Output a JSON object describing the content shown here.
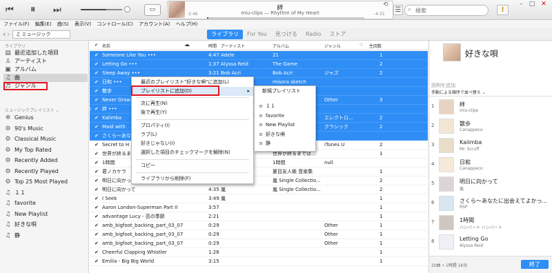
{
  "window": {
    "minimize": "–",
    "maximize": "□",
    "close": "✕"
  },
  "player": {
    "prev_icon": "⏮",
    "pause_icon": "⏸",
    "next_icon": "⏭",
    "shuffle_icon": "⤨",
    "repeat_icon": "⟲",
    "airplay_icon": "▭",
    "elapsed": "2:46",
    "remaining": "-4:31",
    "title": "絆",
    "subtitle": "miu-clips — Rhythm of My Heart",
    "list_icon": "☰"
  },
  "search": {
    "placeholder": "検索",
    "icon": "search-icon"
  },
  "menu": [
    "ファイル(F)",
    "編集(E)",
    "曲(S)",
    "表示(V)",
    "コントロール(C)",
    "アカウント(A)",
    "ヘルプ(H)"
  ],
  "nav": {
    "back": "‹",
    "forward": "›",
    "kind": "♫ ミュージック",
    "tabs": [
      "ライブラリ",
      "For You",
      "見つける",
      "Radio",
      "ストア"
    ]
  },
  "sidebar": {
    "library_header": "ライブラリ",
    "library": [
      {
        "icon": "▤",
        "label": "最近追加した項目"
      },
      {
        "icon": "♙",
        "label": "アーティスト"
      },
      {
        "icon": "▣",
        "label": "アルバム"
      },
      {
        "icon": "♫",
        "label": "曲"
      },
      {
        "icon": "♬",
        "label": "ジャンル"
      }
    ],
    "playlist_header": "ミュージックプレイリスト ⌄",
    "playlists": [
      {
        "icon": "✲",
        "label": "Genius"
      },
      {
        "icon": "⚙",
        "label": "90's Music"
      },
      {
        "icon": "⚙",
        "label": "Classical Music"
      },
      {
        "icon": "⚙",
        "label": "My Top Rated"
      },
      {
        "icon": "⚙",
        "label": "Recently Added"
      },
      {
        "icon": "⚙",
        "label": "Recently Played"
      },
      {
        "icon": "⚙",
        "label": "Top 25 Most Played"
      },
      {
        "icon": "♫",
        "label": "１１"
      },
      {
        "icon": "♫",
        "label": "favorite"
      },
      {
        "icon": "♫",
        "label": "New Playlist"
      },
      {
        "icon": "♫",
        "label": "好きな唄"
      },
      {
        "icon": "♫",
        "label": "静"
      }
    ]
  },
  "table": {
    "headers": {
      "check": "✔",
      "name": "名前",
      "cloud": "☁",
      "time": "時間",
      "artist": "アーティスト",
      "album": "アルバム",
      "genre": "ジャンル",
      "love": "♡",
      "plays": "生回数"
    },
    "rows": [
      {
        "name": "Someone Like You  •••",
        "time": "4:47",
        "artist": "Adele",
        "album": "21",
        "genre": "",
        "plays": "1"
      },
      {
        "name": "Letting Go  •••",
        "time": "1:37",
        "artist": "Alyssa Reid",
        "album": "The Game",
        "genre": "",
        "plays": "2"
      },
      {
        "name": "Sleep Away  •••",
        "time": "3:21",
        "artist": "Bob Acri",
        "album": "Bob Acri",
        "genre": "ジャズ",
        "plays": "2"
      },
      {
        "name": "日和  •••",
        "time": "",
        "artist": "",
        "album": "misora sketch",
        "genre": "",
        "plays": ""
      },
      {
        "name": "散歩",
        "time": "",
        "artist": "",
        "album": "",
        "genre": "",
        "plays": ""
      },
      {
        "name": "Never Grow",
        "time": "",
        "artist": "",
        "album": "",
        "genre": "Other",
        "plays": "3"
      },
      {
        "name": "絆  •••",
        "time": "",
        "artist": "",
        "album": "",
        "genre": "",
        "plays": ""
      },
      {
        "name": "Kalimba",
        "time": "",
        "artist": "",
        "album": "",
        "genre": "エレクトロ...",
        "plays": "2"
      },
      {
        "name": "Maid with",
        "time": "",
        "artist": "",
        "album": "",
        "genre": "クラシック",
        "plays": "2"
      },
      {
        "name": "さくら〜あな",
        "time": "",
        "artist": "",
        "album": "",
        "genre": "",
        "plays": ""
      },
      {
        "name": "Secret to H",
        "time": "",
        "artist": "",
        "album": "",
        "genre": "iTunes U",
        "plays": "2"
      },
      {
        "name": "世界が終るま",
        "time": "",
        "artist": "",
        "album": "世界が終るまでは...",
        "genre": "",
        "plays": "1"
      },
      {
        "name": "1時間",
        "time": "",
        "artist": "ート",
        "album": "1時間",
        "genre": "null",
        "plays": ""
      },
      {
        "name": "君ノカケラ",
        "time": "",
        "artist": "",
        "album": "夏目友人帳 音楽集",
        "genre": "",
        "plays": "1"
      },
      {
        "name": "明日に向かって",
        "time": "",
        "artist": "",
        "album": "嵐 Single Collectio...",
        "genre": "",
        "plays": "2"
      },
      {
        "name": "明日に向かって",
        "time": "4:35",
        "artist": "嵐",
        "album": "嵐 Single Collectio...",
        "genre": "",
        "plays": "2"
      },
      {
        "name": "I Seek",
        "time": "3:49",
        "artist": "嵐",
        "album": "",
        "genre": "",
        "plays": "1"
      },
      {
        "name": "Aaron London-Superman Part II",
        "time": "3:57",
        "artist": "",
        "album": "",
        "genre": "",
        "plays": "1"
      },
      {
        "name": "advantage Lucy - 否の季節",
        "time": "2:21",
        "artist": "",
        "album": "",
        "genre": "",
        "plays": "1"
      },
      {
        "name": "amb_bigfoot_backing_part_03_07",
        "time": "0:29",
        "artist": "",
        "album": "",
        "genre": "Other",
        "plays": "1"
      },
      {
        "name": "amb_bigfoot_backing_part_03_07",
        "time": "0:29",
        "artist": "",
        "album": "",
        "genre": "Other",
        "plays": "1"
      },
      {
        "name": "amb_bigfoot_backing_part_03_07",
        "time": "0:29",
        "artist": "",
        "album": "",
        "genre": "Other",
        "plays": "1"
      },
      {
        "name": "Cheerful Clapping Whistler",
        "time": "1:26",
        "artist": "",
        "album": "",
        "genre": "",
        "plays": "1"
      },
      {
        "name": "Emilia - Big Big World",
        "time": "3:15",
        "artist": "",
        "album": "",
        "genre": "",
        "plays": "1"
      }
    ]
  },
  "context_menu": {
    "items": [
      "最近のプレイリスト\"好きな唄\"に追加(L)",
      "プレイリストに追加(D)",
      "次に再生(N)",
      "後で再生(Y)",
      "プロパティ(I)",
      "ラブ(L)",
      "好きじゃない(I)",
      "選択した項目のチェックマークを解除(N)",
      "コピー",
      "ライブラリから削除(F)"
    ],
    "submenu_arrow": "▸"
  },
  "submenu": {
    "items": [
      "新規プレイリスト",
      "１１",
      "favorite",
      "New Playlist",
      "好きな唄",
      "静"
    ],
    "icon": "≡"
  },
  "right_panel": {
    "playlist_title": "好きな唄",
    "description": "説明を追加",
    "sort_label": "手動による順序で並べ替え ⌄",
    "songs": [
      {
        "n": "1",
        "title": "絆",
        "artist": "miu-clips"
      },
      {
        "n": "2",
        "title": "散歩",
        "artist": "Canappeco"
      },
      {
        "n": "3",
        "title": "Kalimba",
        "artist": "Mr. Scruff"
      },
      {
        "n": "4",
        "title": "日和",
        "artist": "Canappeco"
      },
      {
        "n": "5",
        "title": "明日に向かって",
        "artist": "嵐"
      },
      {
        "n": "6",
        "title": "さくら〜あなたに出会えてよかっ...",
        "artist": "RSP"
      },
      {
        "n": "7",
        "title": "1時間",
        "artist": "ハンバート ハンバート"
      },
      {
        "n": "8",
        "title": "Letting Go",
        "artist": "Alyssa Reid"
      }
    ],
    "footer": "20曲 • 1時間 16分",
    "done": "終了"
  }
}
